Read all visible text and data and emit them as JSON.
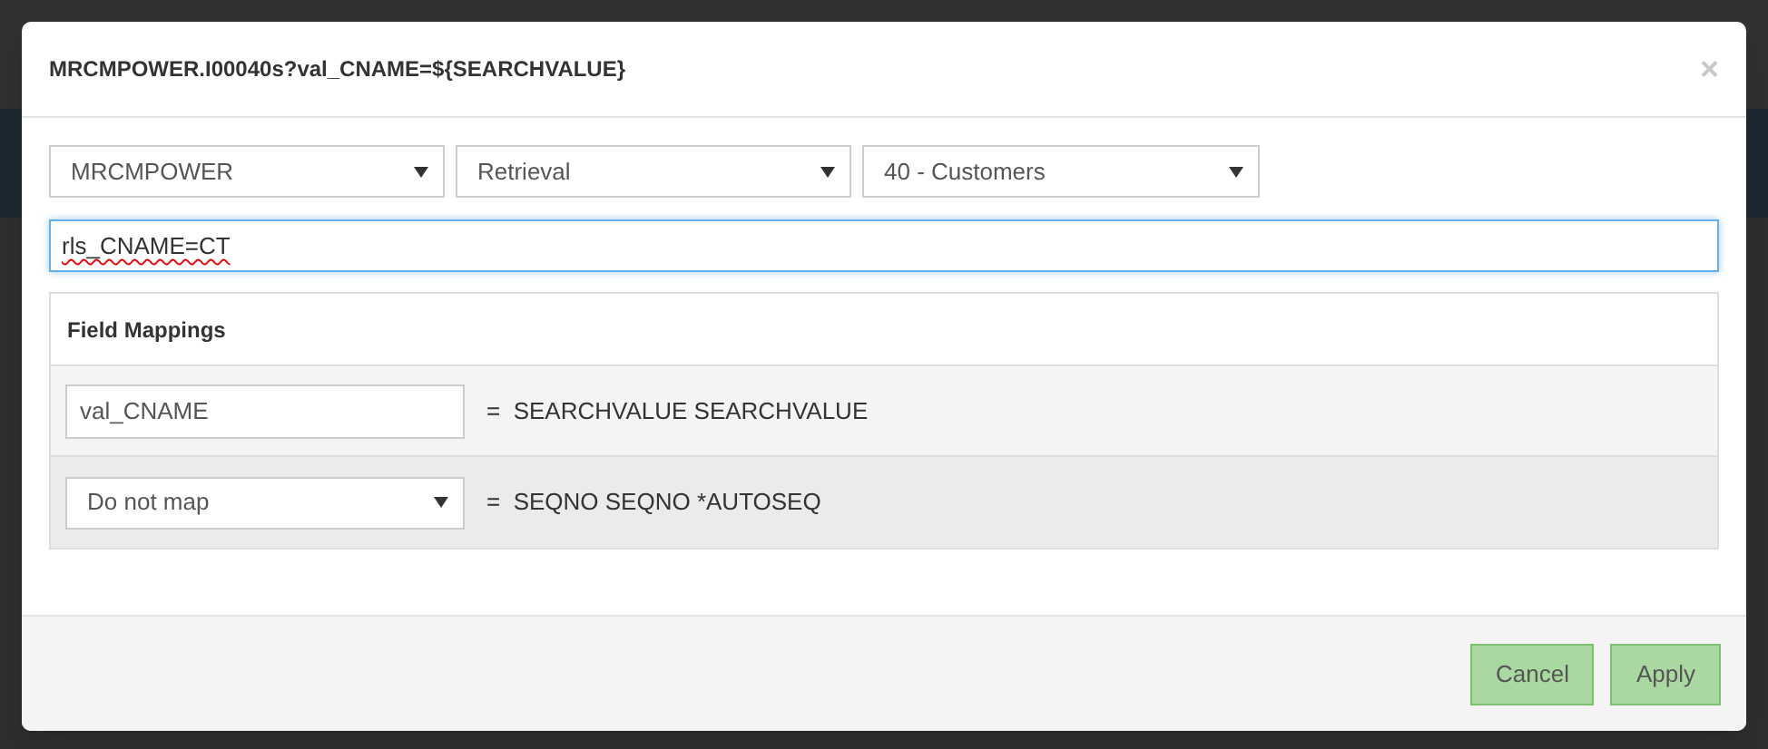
{
  "dialog": {
    "title": "MRCMPOWER.I00040s?val_CNAME=${SEARCHVALUE}",
    "close": "×",
    "selects": [
      {
        "value": "MRCMPOWER"
      },
      {
        "value": "Retrieval"
      },
      {
        "value": "40 - Customers"
      }
    ],
    "query": {
      "value": "rls_CNAME=CT",
      "focused": true
    },
    "mappings": {
      "title": "Field Mappings",
      "rows": [
        {
          "kind": "text",
          "value": "val_CNAME",
          "target": "=  SEARCHVALUE SEARCHVALUE"
        },
        {
          "kind": "select",
          "value": "Do not map",
          "target": "=  SEQNO SEQNO *AUTOSEQ"
        }
      ]
    },
    "buttons": [
      {
        "label": "Cancel"
      },
      {
        "label": "Apply"
      }
    ]
  }
}
